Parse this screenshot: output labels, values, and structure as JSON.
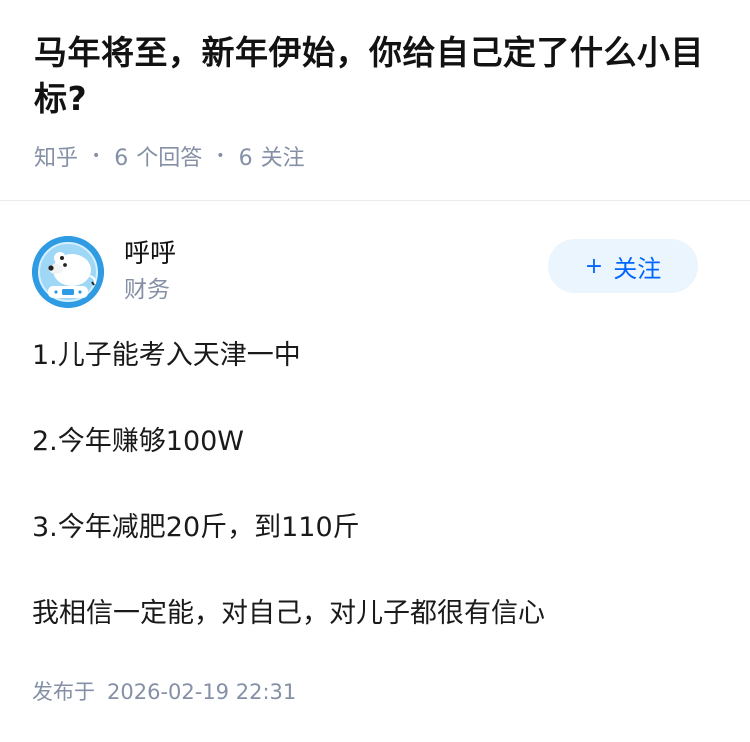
{
  "question": {
    "title": "马年将至，新年伊始，你给自己定了什么小目标?",
    "source": "知乎",
    "answer_count": "6",
    "answer_label": "个回答",
    "follower_count": "6",
    "follower_label": "关注"
  },
  "answer": {
    "author": {
      "name": "呼呼",
      "tag": "财务",
      "avatar_icon": "polar-bear-astronaut-avatar"
    },
    "follow_button": {
      "plus": "+",
      "label": "关注"
    },
    "paragraphs": [
      "1.儿子能考入天津一中",
      "2.今年赚够100W",
      "3.今年减肥20斤，到110斤",
      "我相信一定能，对自己，对儿子都很有信心"
    ],
    "publish_label": "发布于",
    "publish_date": "2026-02-19 22:31"
  },
  "colors": {
    "accent": "#0066ff",
    "follow_bg": "#ebf5fd",
    "meta_gray": "#8590a6",
    "avatar_blue": "#2e9be3"
  }
}
